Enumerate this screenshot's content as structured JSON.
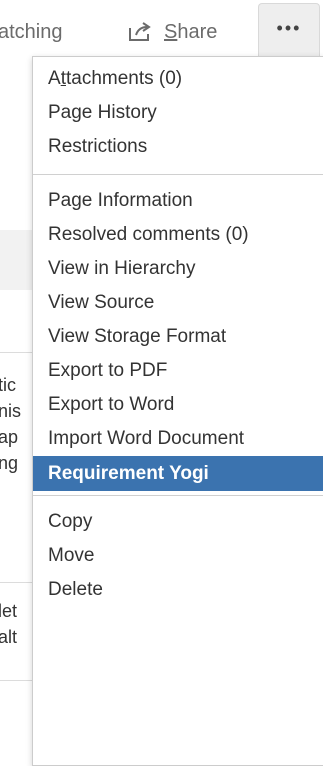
{
  "toolbar": {
    "watching_label": "atching",
    "share_label_prefix": "",
    "share_label_underlined": "S",
    "share_label_rest": "hare",
    "more_icon": "ellipsis-icon",
    "share_icon": "share-icon"
  },
  "background": {
    "lines": [
      "tic",
      "nis",
      "ap",
      "ng",
      "let",
      "alt"
    ]
  },
  "menu": {
    "groups": [
      {
        "items": [
          {
            "label_prefix": "A",
            "label_underlined": "t",
            "label_rest": "tachments (0)"
          },
          {
            "label": "Page History"
          },
          {
            "label": "Restrictions"
          }
        ]
      },
      {
        "items": [
          {
            "label": "Page Information"
          },
          {
            "label": "Resolved comments (0)"
          },
          {
            "label": "View in Hierarchy"
          },
          {
            "label": "View Source"
          },
          {
            "label": "View Storage Format"
          },
          {
            "label": "Export to PDF"
          },
          {
            "label": "Export to Word"
          },
          {
            "label": "Import Word Document"
          },
          {
            "label": "Requirement Yogi",
            "active": true
          }
        ]
      },
      {
        "items": [
          {
            "label": "Copy"
          },
          {
            "label": "Move"
          },
          {
            "label": "Delete"
          }
        ]
      }
    ]
  },
  "colors": {
    "highlight": "#3b73af",
    "menu_text": "#333333",
    "toolbar_text": "#6b6b6b"
  }
}
